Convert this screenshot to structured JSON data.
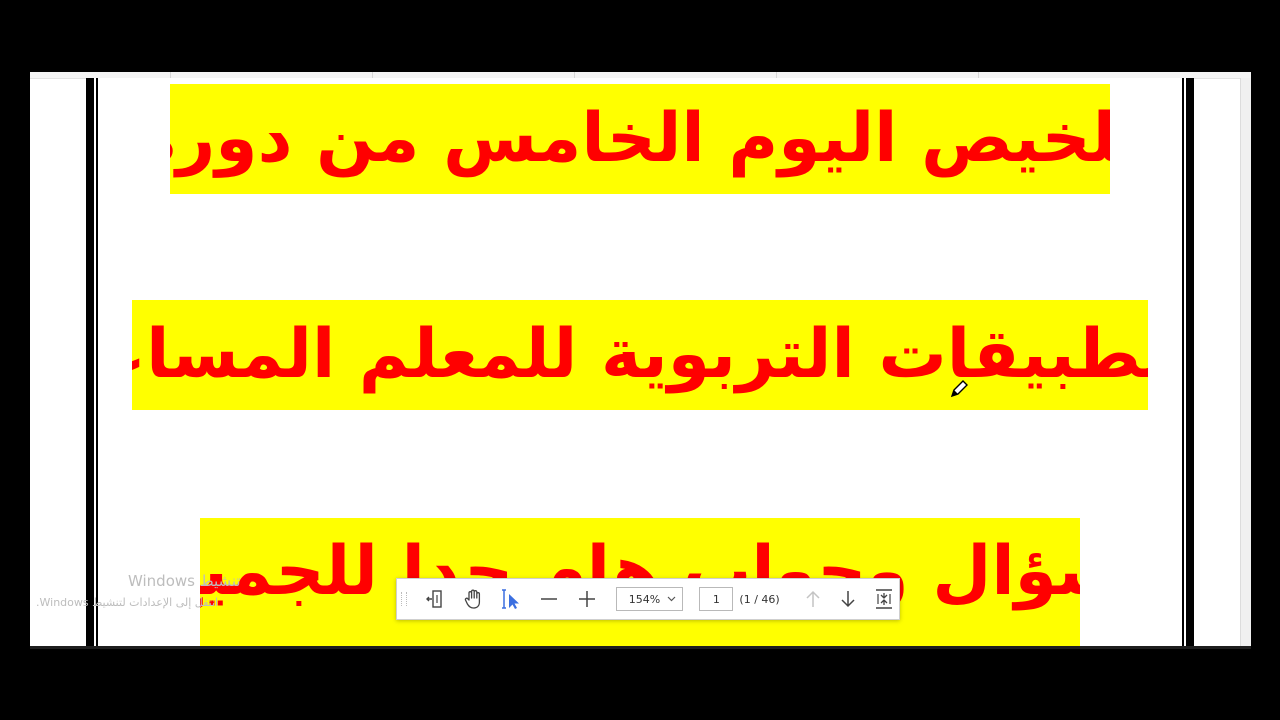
{
  "document": {
    "line1": "تلخيص اليوم الخامس من دورة",
    "line2": "التطبيقات التربوية للمعلم المساعد",
    "line3": "سؤال وجواب هام جدا للجميع"
  },
  "watermark": {
    "title": "Windows تنشيط",
    "subtitle": "انتقل إلى الإعدادات لتنشيط Windows."
  },
  "toolbar": {
    "zoom": "154%",
    "page_current": "1",
    "page_count": "(1 / 46)"
  },
  "colors": {
    "highlight": "#ffff00",
    "text": "#ff0000",
    "select_tool": "#3b6fe0"
  },
  "icons": {
    "fit_width": "fit-width-icon",
    "hand": "hand-tool-icon",
    "select": "text-select-icon",
    "zoom_out": "zoom-out-icon",
    "zoom_in": "zoom-in-icon",
    "prev": "arrow-up-icon",
    "next": "arrow-down-icon",
    "fit_page": "fit-page-icon",
    "pen": "pen-cursor-icon"
  }
}
